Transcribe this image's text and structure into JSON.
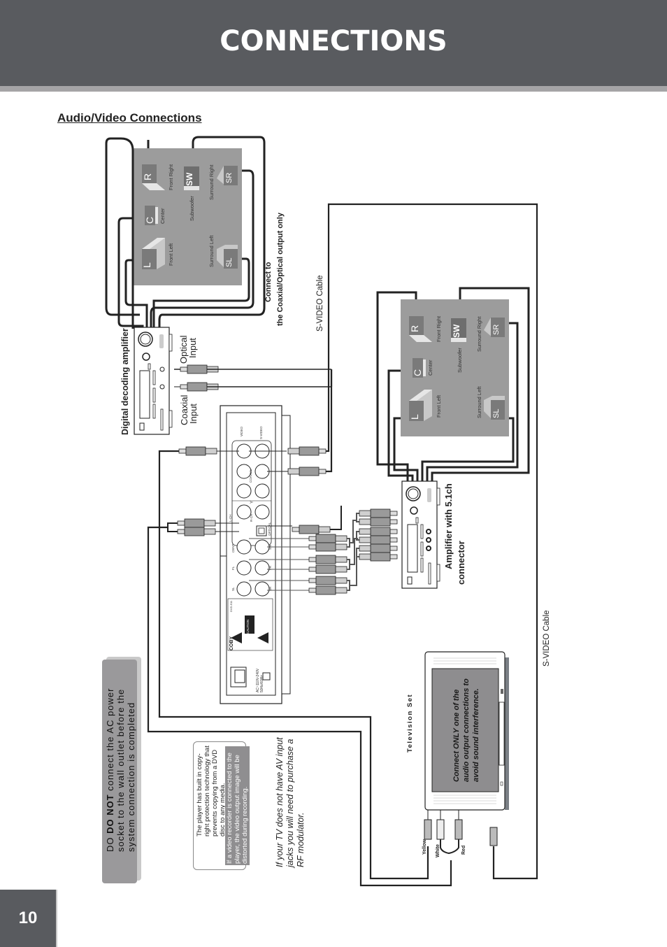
{
  "header": {
    "title": "CONNECTIONS",
    "colors": {
      "bar": "#595b5f",
      "stripe": "#a5a4a6"
    }
  },
  "section": {
    "title": "Audio/Video Connections"
  },
  "page_number": "10",
  "speakers_top": {
    "front_left": {
      "code": "L",
      "label": "Front Left"
    },
    "center": {
      "code": "C",
      "label": "Center"
    },
    "front_right": {
      "code": "R",
      "label": "Front Right"
    },
    "subwoofer": {
      "code": "SW",
      "label": "Subwoofer"
    },
    "surround_left": {
      "code": "SL",
      "label": "Surround Left"
    },
    "surround_right": {
      "code": "SR",
      "label": "Surround Right"
    }
  },
  "speakers_right": {
    "front_left": {
      "code": "L",
      "label": "Front Left"
    },
    "center": {
      "code": "C",
      "label": "Center"
    },
    "front_right": {
      "code": "R",
      "label": "Front Right"
    },
    "subwoofer": {
      "code": "SW",
      "label": "Subwoofer"
    },
    "surround_left": {
      "code": "SL",
      "label": "Surround Left"
    },
    "surround_right": {
      "code": "SR",
      "label": "Surround Right"
    }
  },
  "labels": {
    "digital_amp": "Digital decoding amplifier",
    "optical_input_1": "Optical",
    "optical_input_2": "Input",
    "coaxial_input_1": "Coaxial",
    "coaxial_input_2": "Input",
    "connect_to_1": "Connect to",
    "connect_to_2": "the Coaxial/Optical output only",
    "svideo_cable_1": "S-VIDEO Cable",
    "svideo_cable_2": "S-VIDEO Cable",
    "amp_51_1": "Amplifier with 5.1ch",
    "amp_51_2": "connector",
    "tv_set": "Television Set",
    "yellow": "Yellow",
    "white": "White",
    "red": "Red"
  },
  "player_panel": {
    "video": "VIDEO",
    "svideo": "S-VIDEO",
    "coaxial": "COAXIAL",
    "y": "Y",
    "pr": "Pr/Cr",
    "pb": "Pb/Cb",
    "scan": "P-SCAN",
    "lch": "L-CH",
    "rch": "R-CH",
    "optical": "OPTICAL",
    "cent": "CENT",
    "sw": "SW",
    "fl": "FL",
    "fr": "FR",
    "sl": "SL",
    "sr": "SR",
    "brand": "COBY",
    "model": "DVD-511",
    "caution": "CAUTION",
    "power": "AC~110V-240V  50Hz/60Hz"
  },
  "warnings": {
    "ac_power_bold": "DO NOT",
    "ac_power_pre": "DO ",
    "ac_power_rest": " connect the AC power socket to the wall outlet before the system connection is completed",
    "copy_protection": "The player has built in copy-right protection technology that prevents copying from a DVD disc to any media.",
    "video_recorder": "If a video recorder is connected to the player, the video output image will be distorted during recording.",
    "rf_modulator": "If your TV does not have AV input jacks you will need to purchase a RF modulator.",
    "tv_note_pre": "Connect ",
    "tv_note_bold": "ONLY",
    "tv_note_rest": " one of the audio output connections to avoid sound interference."
  }
}
